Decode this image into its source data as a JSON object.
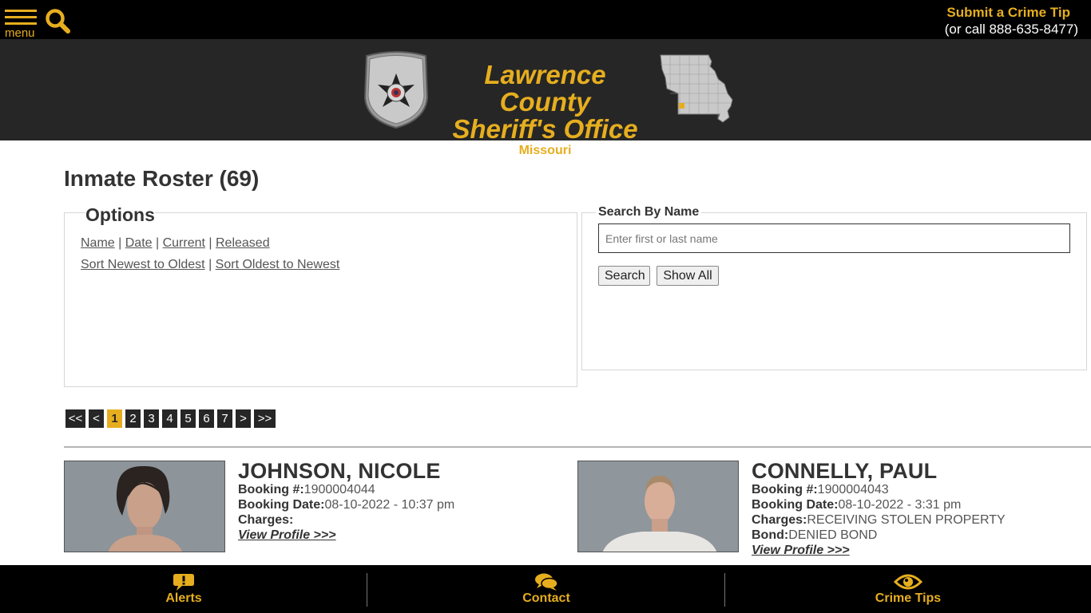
{
  "header": {
    "menu_label": "menu",
    "crime_tip_link": "Submit a Crime Tip",
    "crime_tip_phone": "(or call 888-635-8477)"
  },
  "banner": {
    "title_line1": "Lawrence County",
    "title_line2": "Sheriff's Office",
    "state": "Missouri",
    "badge_text": "SHERIFF"
  },
  "page": {
    "title": "Inmate Roster (69)"
  },
  "options": {
    "legend": "Options",
    "filter_links": [
      "Name",
      "Date",
      "Current",
      "Released"
    ],
    "sort_links": [
      "Sort Newest to Oldest",
      "Sort Oldest to Newest"
    ],
    "separator": " | "
  },
  "search": {
    "legend": "Search By Name",
    "placeholder": "Enter first or last name",
    "search_button": "Search",
    "show_all_button": "Show All"
  },
  "pagination": {
    "items": [
      "<<",
      "<",
      "1",
      "2",
      "3",
      "4",
      "5",
      "6",
      "7",
      ">",
      ">>"
    ],
    "active_index": 2
  },
  "inmates": [
    {
      "name": "JOHNSON, NICOLE",
      "booking_label": "Booking #:",
      "booking_number": "1900004044",
      "date_label": "Booking Date:",
      "booking_date": "08-10-2022 - 10:37 pm",
      "charges_label": "Charges:",
      "charges": "",
      "link": "View Profile >>>"
    },
    {
      "name": "CONNELLY, PAUL",
      "booking_label": "Booking #:",
      "booking_number": "1900004043",
      "date_label": "Booking Date:",
      "booking_date": "08-10-2022 - 3:31 pm",
      "charges_label": "Charges:",
      "charges": "RECEIVING STOLEN PROPERTY",
      "bond_label": "Bond:",
      "bond": "DENIED BOND",
      "link": "View Profile >>>"
    }
  ],
  "footer": {
    "alerts": "Alerts",
    "contact": "Contact",
    "crime_tips": "Crime Tips"
  },
  "colors": {
    "accent": "#e6ae1f",
    "topbar": "#000000",
    "banner": "#262626"
  }
}
